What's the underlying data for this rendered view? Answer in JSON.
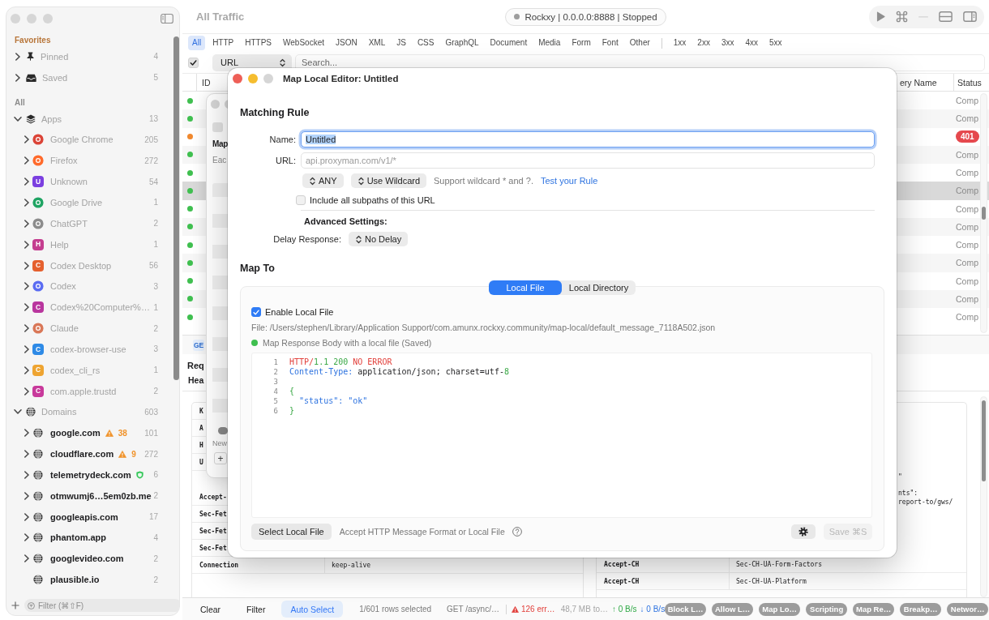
{
  "sidebar": {
    "favorites_title": "Favorites",
    "favorites": [
      {
        "label": "Pinned",
        "count": "4",
        "kind": "pin",
        "expanded": false
      },
      {
        "label": "Saved",
        "count": "5",
        "kind": "tray",
        "expanded": false
      }
    ],
    "all_title": "All",
    "groups": [
      {
        "label": "Apps",
        "count": "13",
        "kind": "apps",
        "expanded": true,
        "children": [
          {
            "label": "Google Chrome",
            "count": "205",
            "kind": "logo",
            "color": "#db4437",
            "expandable": true,
            "expanded": false
          },
          {
            "label": "Firefox",
            "count": "272",
            "kind": "logo",
            "color": "#ff6a2b",
            "expandable": true,
            "expanded": false
          },
          {
            "label": "Unknown",
            "count": "54",
            "kind": "letter",
            "letter": "U",
            "color": "#7b3fe0",
            "expandable": true,
            "expanded": false
          },
          {
            "label": "Google Drive",
            "count": "1",
            "kind": "logo",
            "color": "#1fa463",
            "expandable": true,
            "expanded": false
          },
          {
            "label": "ChatGPT",
            "count": "2",
            "kind": "logo",
            "color": "#8c8c8c",
            "expandable": true,
            "expanded": false
          },
          {
            "label": "Help",
            "count": "1",
            "kind": "letter",
            "letter": "H",
            "color": "#c43d8f",
            "expandable": true,
            "expanded": false
          },
          {
            "label": "Codex Desktop",
            "count": "56",
            "kind": "letter",
            "letter": "C",
            "color": "#e5602e",
            "expandable": true,
            "expanded": false
          },
          {
            "label": "Codex",
            "count": "3",
            "kind": "logo",
            "color": "#5a6cf2",
            "expandable": true,
            "expanded": false
          },
          {
            "label": "Codex%20Computer%…",
            "count": "1",
            "kind": "letter",
            "letter": "C",
            "color": "#b9369e",
            "expandable": true,
            "expanded": false
          },
          {
            "label": "Claude",
            "count": "2",
            "kind": "logo",
            "color": "#d97757",
            "expandable": true,
            "expanded": false
          },
          {
            "label": "codex-browser-use",
            "count": "3",
            "kind": "letter",
            "letter": "C",
            "color": "#2e8ae6",
            "expandable": true,
            "expanded": false
          },
          {
            "label": "codex_cli_rs",
            "count": "1",
            "kind": "letter",
            "letter": "C",
            "color": "#eea431",
            "expandable": true,
            "expanded": false
          },
          {
            "label": "com.apple.trustd",
            "count": "2",
            "kind": "letter",
            "letter": "C",
            "color": "#c8399b",
            "expandable": true,
            "expanded": false
          }
        ]
      },
      {
        "label": "Domains",
        "count": "603",
        "kind": "domains",
        "expanded": true,
        "children": [
          {
            "label": "google.com",
            "count": "101",
            "kind": "domain",
            "warning_count": "38",
            "shield": false,
            "expandable": true,
            "expanded": false
          },
          {
            "label": "cloudflare.com",
            "count": "272",
            "kind": "domain",
            "warning_count": "9",
            "shield": false,
            "expandable": true,
            "expanded": false
          },
          {
            "label": "telemetrydeck.com",
            "count": "6",
            "kind": "domain",
            "shield": true,
            "expandable": true,
            "expanded": false
          },
          {
            "label": "otmwumj6…5em0zb.me",
            "count": "2",
            "kind": "domain",
            "shield": false,
            "expandable": true,
            "expanded": false
          },
          {
            "label": "googleapis.com",
            "count": "17",
            "kind": "domain",
            "shield": false,
            "expandable": true,
            "expanded": false
          },
          {
            "label": "phantom.app",
            "count": "4",
            "kind": "domain",
            "shield": false,
            "expandable": true,
            "expanded": false
          },
          {
            "label": "googlevideo.com",
            "count": "2",
            "kind": "domain",
            "shield": false,
            "expandable": true,
            "expanded": false
          },
          {
            "label": "plausible.io",
            "count": "2",
            "kind": "domain",
            "shield": false,
            "expandable": false
          }
        ]
      }
    ],
    "filter": {
      "placeholder": "Filter (⌘⇧F)"
    }
  },
  "toolbar": {
    "title": "All Traffic",
    "proxy_status": "Rockxy | 0.0.0.0:8888 | Stopped",
    "running": false,
    "tools": [
      {
        "kind": "play",
        "disabled": false
      },
      {
        "kind": "command",
        "disabled": false
      },
      {
        "kind": "minus",
        "disabled": true
      },
      {
        "kind": "split",
        "disabled": false
      },
      {
        "kind": "sidebar",
        "disabled": false
      }
    ]
  },
  "type_filters": [
    {
      "label": "All",
      "selected": true
    },
    {
      "label": "HTTP",
      "selected": false
    },
    {
      "label": "HTTPS",
      "selected": false
    },
    {
      "label": "WebSocket",
      "selected": false
    },
    {
      "label": "JSON",
      "selected": false
    },
    {
      "label": "XML",
      "selected": false
    },
    {
      "label": "JS",
      "selected": false
    },
    {
      "label": "CSS",
      "selected": false
    },
    {
      "label": "GraphQL",
      "selected": false
    },
    {
      "label": "Document",
      "selected": false
    },
    {
      "label": "Media",
      "selected": false
    },
    {
      "label": "Form",
      "selected": false
    },
    {
      "label": "Font",
      "selected": false
    },
    {
      "label": "Other",
      "selected": false
    }
  ],
  "status_filters": [
    {
      "label": "1xx",
      "selected": false
    },
    {
      "label": "2xx",
      "selected": false
    },
    {
      "label": "3xx",
      "selected": false
    },
    {
      "label": "4xx",
      "selected": false
    },
    {
      "label": "5xx",
      "selected": false
    }
  ],
  "search": {
    "enabled": true,
    "scope": "URL",
    "placeholder": "Search..."
  },
  "table": {
    "columns": [
      "ID",
      "ery Name",
      "Status"
    ],
    "rows": [
      {
        "color": "#3fbf4f",
        "status": "Comp",
        "error": false,
        "selected": false
      },
      {
        "color": "#3fbf4f",
        "status": "Comp",
        "error": false,
        "selected": false
      },
      {
        "color": "#f0882e",
        "status": "401",
        "error": true,
        "selected": false
      },
      {
        "color": "#3fbf4f",
        "status": "Comp",
        "error": false,
        "selected": false
      },
      {
        "color": "#3fbf4f",
        "status": "Comp",
        "error": false,
        "selected": false
      },
      {
        "color": "#3fbf4f",
        "status": "Comp",
        "error": false,
        "selected": true
      },
      {
        "color": "#3fbf4f",
        "status": "Comp",
        "error": false,
        "selected": false
      },
      {
        "color": "#3fbf4f",
        "status": "Comp",
        "error": false,
        "selected": false
      },
      {
        "color": "#3fbf4f",
        "status": "Comp",
        "error": false,
        "selected": false
      },
      {
        "color": "#3fbf4f",
        "status": "Comp",
        "error": false,
        "selected": false
      },
      {
        "color": "#3fbf4f",
        "status": "Comp",
        "error": false,
        "selected": false
      },
      {
        "color": "#3fbf4f",
        "status": "Comp",
        "error": false,
        "selected": false
      },
      {
        "color": "#3fbf4f",
        "status": "Comp",
        "error": false,
        "selected": false
      }
    ]
  },
  "detail": {
    "method": "GE",
    "title": "Req",
    "tab": "Hea",
    "left_rows": [
      {
        "key": "K"
      },
      {
        "key": "A"
      },
      {
        "key": "H"
      },
      {
        "key": "U"
      },
      {
        "key": "Accept-"
      },
      {
        "key": "Sec-Fet"
      },
      {
        "key": "Sec-Fet"
      },
      {
        "key": "Sec-Fet"
      },
      {
        "key": "Connection",
        "value": "keep-alive"
      }
    ],
    "right_fragments": [
      "\"",
      "nts\":",
      "report-to/gws/"
    ],
    "right_rows": [
      {
        "key": "Accept-CH",
        "value": "Sec-CH-UA-Form-Factors"
      },
      {
        "key": "Accept-CH",
        "value": "Sec-CH-UA-Platform"
      }
    ]
  },
  "background_window": {
    "checked": false,
    "title": "Map",
    "subtitle": "Eac",
    "footer": "New",
    "add_button": "+"
  },
  "dialog": {
    "title": "Map Local Editor: Untitled",
    "matching_title": "Matching Rule",
    "name_label": "Name:",
    "name_field": {
      "value": "Untitled",
      "focused": true,
      "text_selected": true
    },
    "url_label": "URL:",
    "url_placeholder": "api.proxyman.com/v1/*",
    "method_button": "ANY",
    "match_button": "Use Wildcard",
    "hint": "Support wildcard * and ?.",
    "test_link": "Test your Rule",
    "subpaths": {
      "label": "Include all subpaths of this URL",
      "checked": false
    },
    "advanced_title": "Advanced Settings:",
    "delay_label": "Delay Response:",
    "delay_button": "No Delay",
    "map_to_title": "Map To",
    "segments": [
      {
        "label": "Local File",
        "selected": true
      },
      {
        "label": "Local Directory",
        "selected": false
      }
    ],
    "enable": {
      "label": "Enable Local File",
      "checked": true
    },
    "file_path": "File: /Users/stephen/Library/Application Support/com.amunx.rockxy.community/map-local/default_message_7118A502.json",
    "saved_status": {
      "text": "Map Response Body with a local file (Saved)",
      "saved": true
    },
    "editor": {
      "lines": [
        {
          "number": "1",
          "tokens": [
            {
              "text": "HTTP/",
              "kind": "protocol"
            },
            {
              "text": "1.1 200",
              "kind": "number"
            },
            {
              "text": " NO ERROR",
              "kind": "reason"
            }
          ]
        },
        {
          "number": "2",
          "tokens": [
            {
              "text": "Content-Type:",
              "kind": "header"
            },
            {
              "text": " application/json; charset=utf-",
              "kind": "plain"
            },
            {
              "text": "8",
              "kind": "number"
            }
          ]
        },
        {
          "number": "3"
        },
        {
          "number": "4",
          "tokens": [
            {
              "text": "{",
              "kind": "punct"
            }
          ]
        },
        {
          "number": "5",
          "tokens": [
            {
              "text": "  \"status\": \"ok\"",
              "kind": "string"
            }
          ]
        },
        {
          "number": "6",
          "tokens": [
            {
              "text": "}",
              "kind": "punct"
            }
          ]
        }
      ]
    },
    "select_button": "Select Local File",
    "format_hint": "Accept HTTP Message Format or Local File",
    "save_button": {
      "label": "Save ⌘S",
      "disabled": true
    }
  },
  "status_bar": {
    "buttons": [
      {
        "label": "Clear",
        "selected": false
      },
      {
        "label": "Filter",
        "selected": false
      },
      {
        "label": "Auto Select",
        "selected": true
      }
    ],
    "selection": "1/601 rows selected",
    "request": "GET /async/…",
    "errors": "126 err…",
    "memory": "48,7 MB to…",
    "upload": "↑ 0 B/s",
    "download": "↓ 0 B/s",
    "tools": [
      {
        "label": "Block L…",
        "on": false
      },
      {
        "label": "Allow L…",
        "on": false
      },
      {
        "label": "Map Lo…",
        "on": false
      },
      {
        "label": "Scripting",
        "on": false
      },
      {
        "label": "Map Re…",
        "on": false
      },
      {
        "label": "Breakp…",
        "on": false
      },
      {
        "label": "Networ…",
        "on": false
      }
    ]
  }
}
